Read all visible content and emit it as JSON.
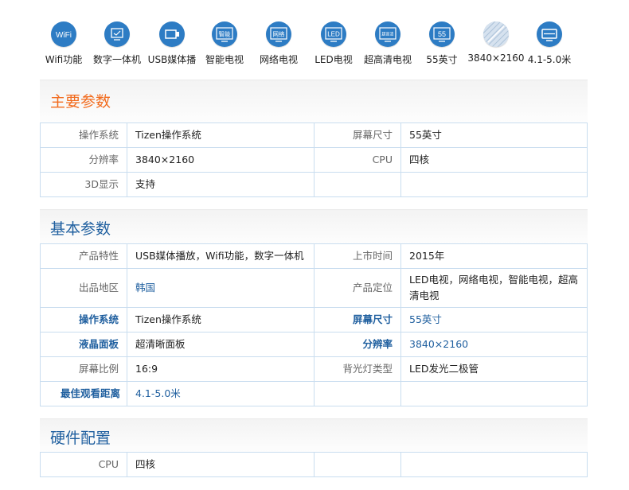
{
  "features": [
    {
      "icon": "wifi-icon",
      "glyph": "WiFi",
      "label": "Wifi功能"
    },
    {
      "icon": "all-in-one-icon",
      "glyph": "",
      "label": "数字一体机"
    },
    {
      "icon": "usb-media-icon",
      "glyph": "",
      "label": "USB媒体播"
    },
    {
      "icon": "smart-tv-icon",
      "glyph": "智能",
      "label": "智能电视"
    },
    {
      "icon": "network-tv-icon",
      "glyph": "网络",
      "label": "网络电视"
    },
    {
      "icon": "led-tv-icon",
      "glyph": "LED",
      "label": "LED电视"
    },
    {
      "icon": "uhd-tv-icon",
      "glyph": "超高清",
      "label": "超高清电视"
    },
    {
      "icon": "screen-size-icon",
      "glyph": "55",
      "label": "55英寸"
    },
    {
      "icon": "resolution-icon",
      "glyph": "",
      "label": "3840×2160"
    },
    {
      "icon": "viewing-distance-icon",
      "glyph": "",
      "label": "4.1-5.0米"
    }
  ],
  "sections": {
    "main": {
      "title": "主要参数",
      "rows": [
        {
          "k1": "操作系统",
          "v1": "Tizen操作系统",
          "k2": "屏幕尺寸",
          "v2": "55英寸"
        },
        {
          "k1": "分辨率",
          "v1": "3840×2160",
          "k2": "CPU",
          "v2": "四核"
        },
        {
          "k1": "3D显示",
          "v1": "支持",
          "k2": "",
          "v2": ""
        }
      ]
    },
    "basic": {
      "title": "基本参数",
      "rows": [
        {
          "k1": "产品特性",
          "v1": "USB媒体播放，Wifi功能，数字一体机",
          "k2": "上市时间",
          "v2": "2015年"
        },
        {
          "k1": "出品地区",
          "v1": "韩国",
          "k2": "产品定位",
          "v2": "LED电视，网络电视，智能电视，超高清电视"
        },
        {
          "k1": "操作系统",
          "v1": "Tizen操作系统",
          "k2": "屏幕尺寸",
          "v2": "55英寸"
        },
        {
          "k1": "液晶面板",
          "v1": "超清晰面板",
          "k2": "分辨率",
          "v2": "3840×2160"
        },
        {
          "k1": "屏幕比例",
          "v1": "16:9",
          "k2": "背光灯类型",
          "v2": "LED发光二极管"
        },
        {
          "k1": "最佳观看距离",
          "v1": "4.1-5.0米",
          "k2": "",
          "v2": ""
        }
      ]
    },
    "hardware": {
      "title": "硬件配置",
      "rows": [
        {
          "k1": "CPU",
          "v1": "四核",
          "k2": "",
          "v2": ""
        }
      ]
    }
  },
  "colors": {
    "accent_blue": "#1f5f9f",
    "icon_blue": "#2d7cc4",
    "highlight_orange": "#f26b1d",
    "table_border": "#c9ddef"
  }
}
